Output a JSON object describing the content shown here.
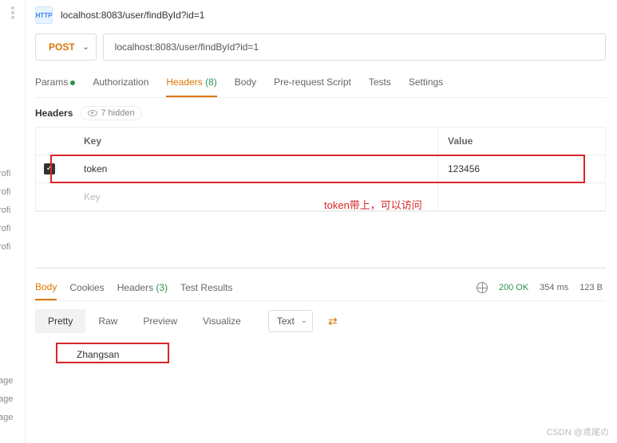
{
  "tab": {
    "title": "localhost:8083/user/findById?id=1",
    "badge": "HTTP"
  },
  "request": {
    "method": "POST",
    "url": "localhost:8083/user/findById?id=1"
  },
  "reqTabs": {
    "params": "Params",
    "auth": "Authorization",
    "headers_label": "Headers",
    "headers_count": "(8)",
    "body": "Body",
    "prereq": "Pre-request Script",
    "tests": "Tests",
    "settings": "Settings"
  },
  "headersSub": {
    "label": "Headers",
    "hidden": "7 hidden"
  },
  "grid": {
    "head_key": "Key",
    "head_val": "Value",
    "row1_key": "token",
    "row1_val": "123456",
    "ph_key": "Key"
  },
  "annotation": "token带上，可以访问",
  "leftLabels": [
    "rofi",
    "rofi",
    "rofi",
    "rofi",
    "rofi"
  ],
  "leftLabels2": [
    "age",
    "age",
    "age"
  ],
  "respTabs": {
    "body": "Body",
    "cookies": "Cookies",
    "headers_label": "Headers",
    "headers_count": "(3)",
    "tests": "Test Results"
  },
  "status": {
    "code": "200 OK",
    "time": "354 ms",
    "size": "123 B"
  },
  "viewTabs": {
    "pretty": "Pretty",
    "raw": "Raw",
    "preview": "Preview",
    "visualize": "Visualize",
    "text": "Text"
  },
  "responseBody": "Zhangsan",
  "watermark": "CSDN @鸢尾の"
}
